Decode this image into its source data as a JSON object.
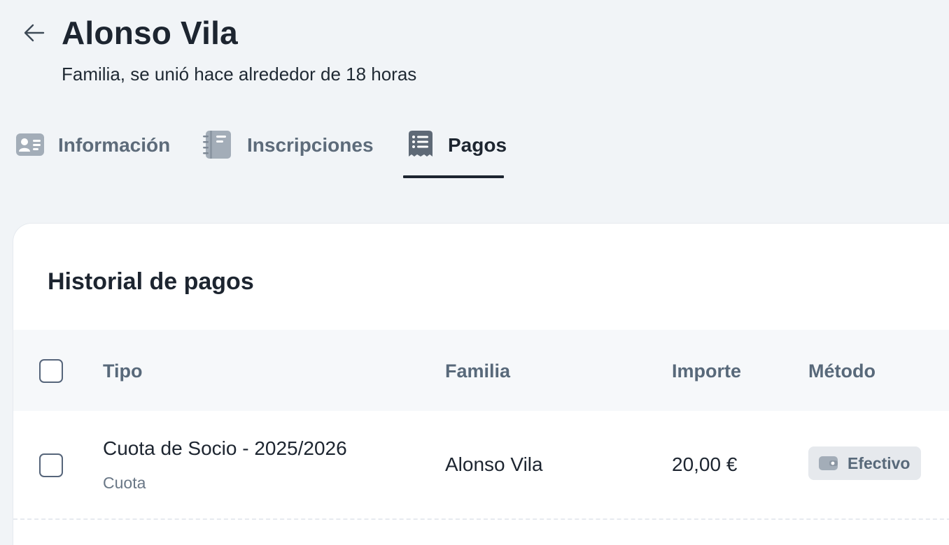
{
  "header": {
    "title": "Alonso Vila",
    "subtitle": "Familia, se unió hace alrededor de 18 horas"
  },
  "tabs": [
    {
      "label": "Información",
      "icon": "id-card-icon",
      "active": false
    },
    {
      "label": "Inscripciones",
      "icon": "notebook-icon",
      "active": false
    },
    {
      "label": "Pagos",
      "icon": "receipt-icon",
      "active": true
    }
  ],
  "payments": {
    "title": "Historial de pagos",
    "columns": {
      "tipo": "Tipo",
      "familia": "Familia",
      "importe": "Importe",
      "metodo": "Método"
    },
    "rows": [
      {
        "tipo": "Cuota de Socio - 2025/2026",
        "tipo_sub": "Cuota",
        "familia": "Alonso Vila",
        "importe": "20,00 €",
        "metodo": "Efectivo",
        "metodo_icon": "wallet-icon"
      }
    ]
  },
  "colors": {
    "background": "#f1f4f7",
    "text_primary": "#1d2530",
    "text_muted": "#58697a",
    "active_tab": "#1d2530",
    "badge_bg": "#e6e9ed"
  }
}
